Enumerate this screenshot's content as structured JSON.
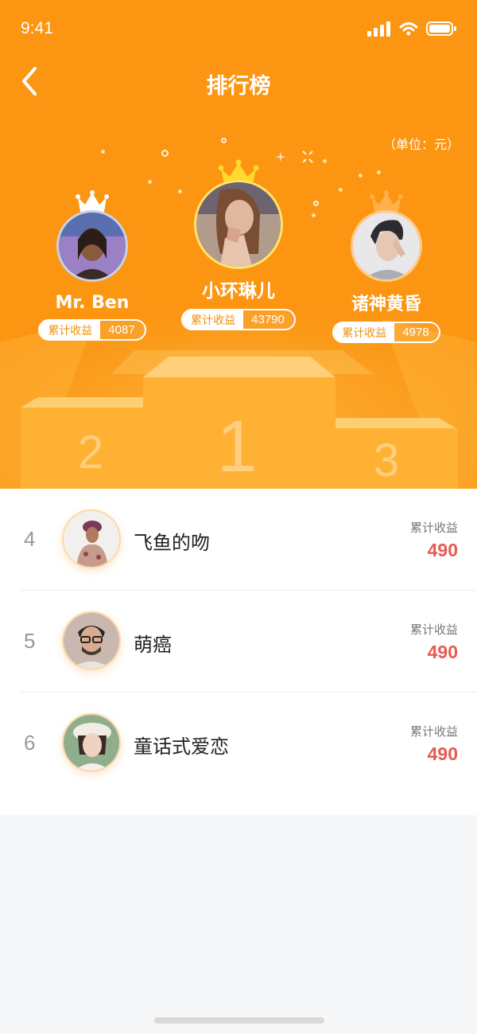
{
  "status_bar": {
    "time": "9:41"
  },
  "header": {
    "title": "排行榜",
    "unit": "（单位：元）"
  },
  "podium": {
    "first": {
      "rank": "1",
      "name": "小环琳儿",
      "earn_label": "累计收益",
      "earn_value": "43790"
    },
    "second": {
      "rank": "2",
      "name": "Mr. Ben",
      "earn_label": "累计收益",
      "earn_value": "4087"
    },
    "third": {
      "rank": "3",
      "name": "诸神黄昏",
      "earn_label": "累计收益",
      "earn_value": "4978"
    }
  },
  "list": [
    {
      "rank": "4",
      "name": "飞鱼的吻",
      "earn_label": "累计收益",
      "earn_value": "490"
    },
    {
      "rank": "5",
      "name": "萌癌",
      "earn_label": "累计收益",
      "earn_value": "490"
    },
    {
      "rank": "6",
      "name": "童话式爱恋",
      "earn_label": "累计收益",
      "earn_value": "490"
    }
  ],
  "colors": {
    "brand": "#fb9512",
    "podium": "#ffb133",
    "value_red": "#e85a4f"
  },
  "icons": {
    "back": "chevron-left-icon",
    "crown": "crown-icon"
  }
}
